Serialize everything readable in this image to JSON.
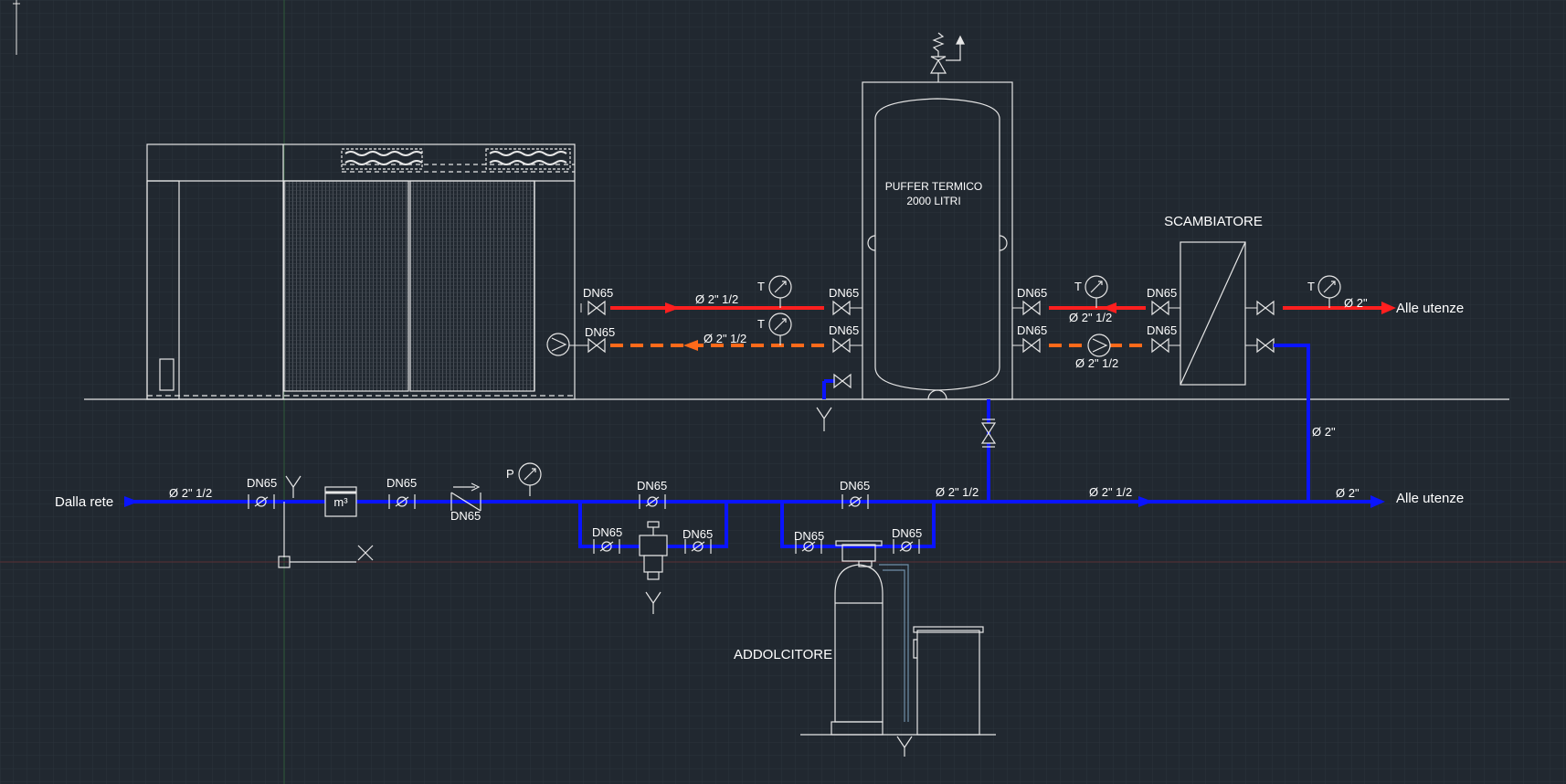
{
  "colors": {
    "background": "#212830",
    "grid": "#2b333c",
    "line": "#e6e6e6",
    "supply_red": "#ff1f1f",
    "return_orange": "#ff6a1a",
    "cold_blue": "#0a14ff"
  },
  "labels": {
    "buffer_line1": "PUFFER TERMICO",
    "buffer_line2": "2000 LITRI",
    "exchanger": "SCAMBIATORE",
    "softener": "ADDOLCITORE",
    "from_network": "Dalla rete",
    "to_users_top": "Alle utenze",
    "to_users_bottom": "Alle utenze",
    "dn": "DN65",
    "meter": "m³",
    "temp_symbol": "T",
    "pressure_symbol": "P",
    "pipe_2_half_1": "Ø  2\" 1/2",
    "pipe_2_half_2": "Ø  2\" 1/2",
    "pipe_2_half_3": "Ø  2\" 1/2",
    "pipe_2_half_4": "Ø  2\" 1/2",
    "pipe_2_half_5": "Ø  2\" 1/2",
    "pipe_2_half_6": "Ø  2\" 1/2",
    "pipe_2_half_7": "Ø  2\" 1/2",
    "pipe_2_1": "Ø  2\"",
    "pipe_2_2": "Ø  2\"",
    "pipe_2_3": "Ø  2\""
  }
}
